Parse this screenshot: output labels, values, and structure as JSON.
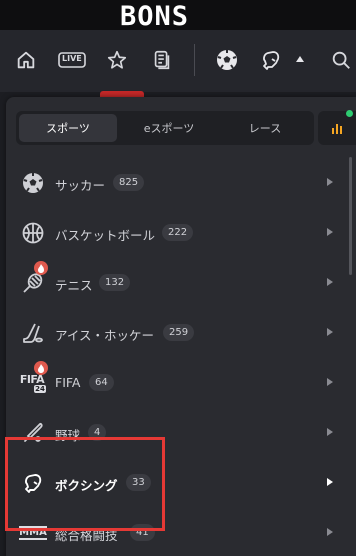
{
  "brand": {
    "logo": "BONS"
  },
  "navbar": {
    "icons": [
      "home-icon",
      "live-icon",
      "star-icon",
      "betslip-icon",
      "soccer-ball-icon",
      "boxing-glove-icon",
      "search-icon"
    ],
    "live_label": "LIVE"
  },
  "sports_tabs": [
    {
      "label": "スポーツ",
      "active": true
    },
    {
      "label": "eスポーツ",
      "active": false
    },
    {
      "label": "レース",
      "active": false
    }
  ],
  "sports_list": [
    {
      "icon": "soccer-ball-icon",
      "label": "サッカー",
      "count": "825",
      "hot": false,
      "selected": false
    },
    {
      "icon": "basketball-icon",
      "label": "バスケットボール",
      "count": "222",
      "hot": false,
      "selected": false
    },
    {
      "icon": "tennis-icon",
      "label": "テニス",
      "count": "132",
      "hot": true,
      "selected": false
    },
    {
      "icon": "ice-hockey-icon",
      "label": "アイス・ホッケー",
      "count": "259",
      "hot": false,
      "selected": false
    },
    {
      "icon": "fifa-icon",
      "label": "FIFA",
      "count": "64",
      "hot": true,
      "selected": false,
      "icon_text": "FIFA",
      "icon_subtext": "24"
    },
    {
      "icon": "baseball-icon",
      "label": "野球",
      "count": "4",
      "hot": false,
      "selected": false
    },
    {
      "icon": "boxing-glove-icon",
      "label": "ボクシング",
      "count": "33",
      "hot": false,
      "selected": true
    },
    {
      "icon": "mma-icon",
      "label": "総合格闘技",
      "count": "41",
      "hot": false,
      "selected": false,
      "icon_text": "MMA"
    }
  ],
  "colors": {
    "highlight_box": "#e53935",
    "hot_badge": "#e05a4e",
    "online_dot": "#2ecc71",
    "stats_icon": "#f5a623"
  }
}
